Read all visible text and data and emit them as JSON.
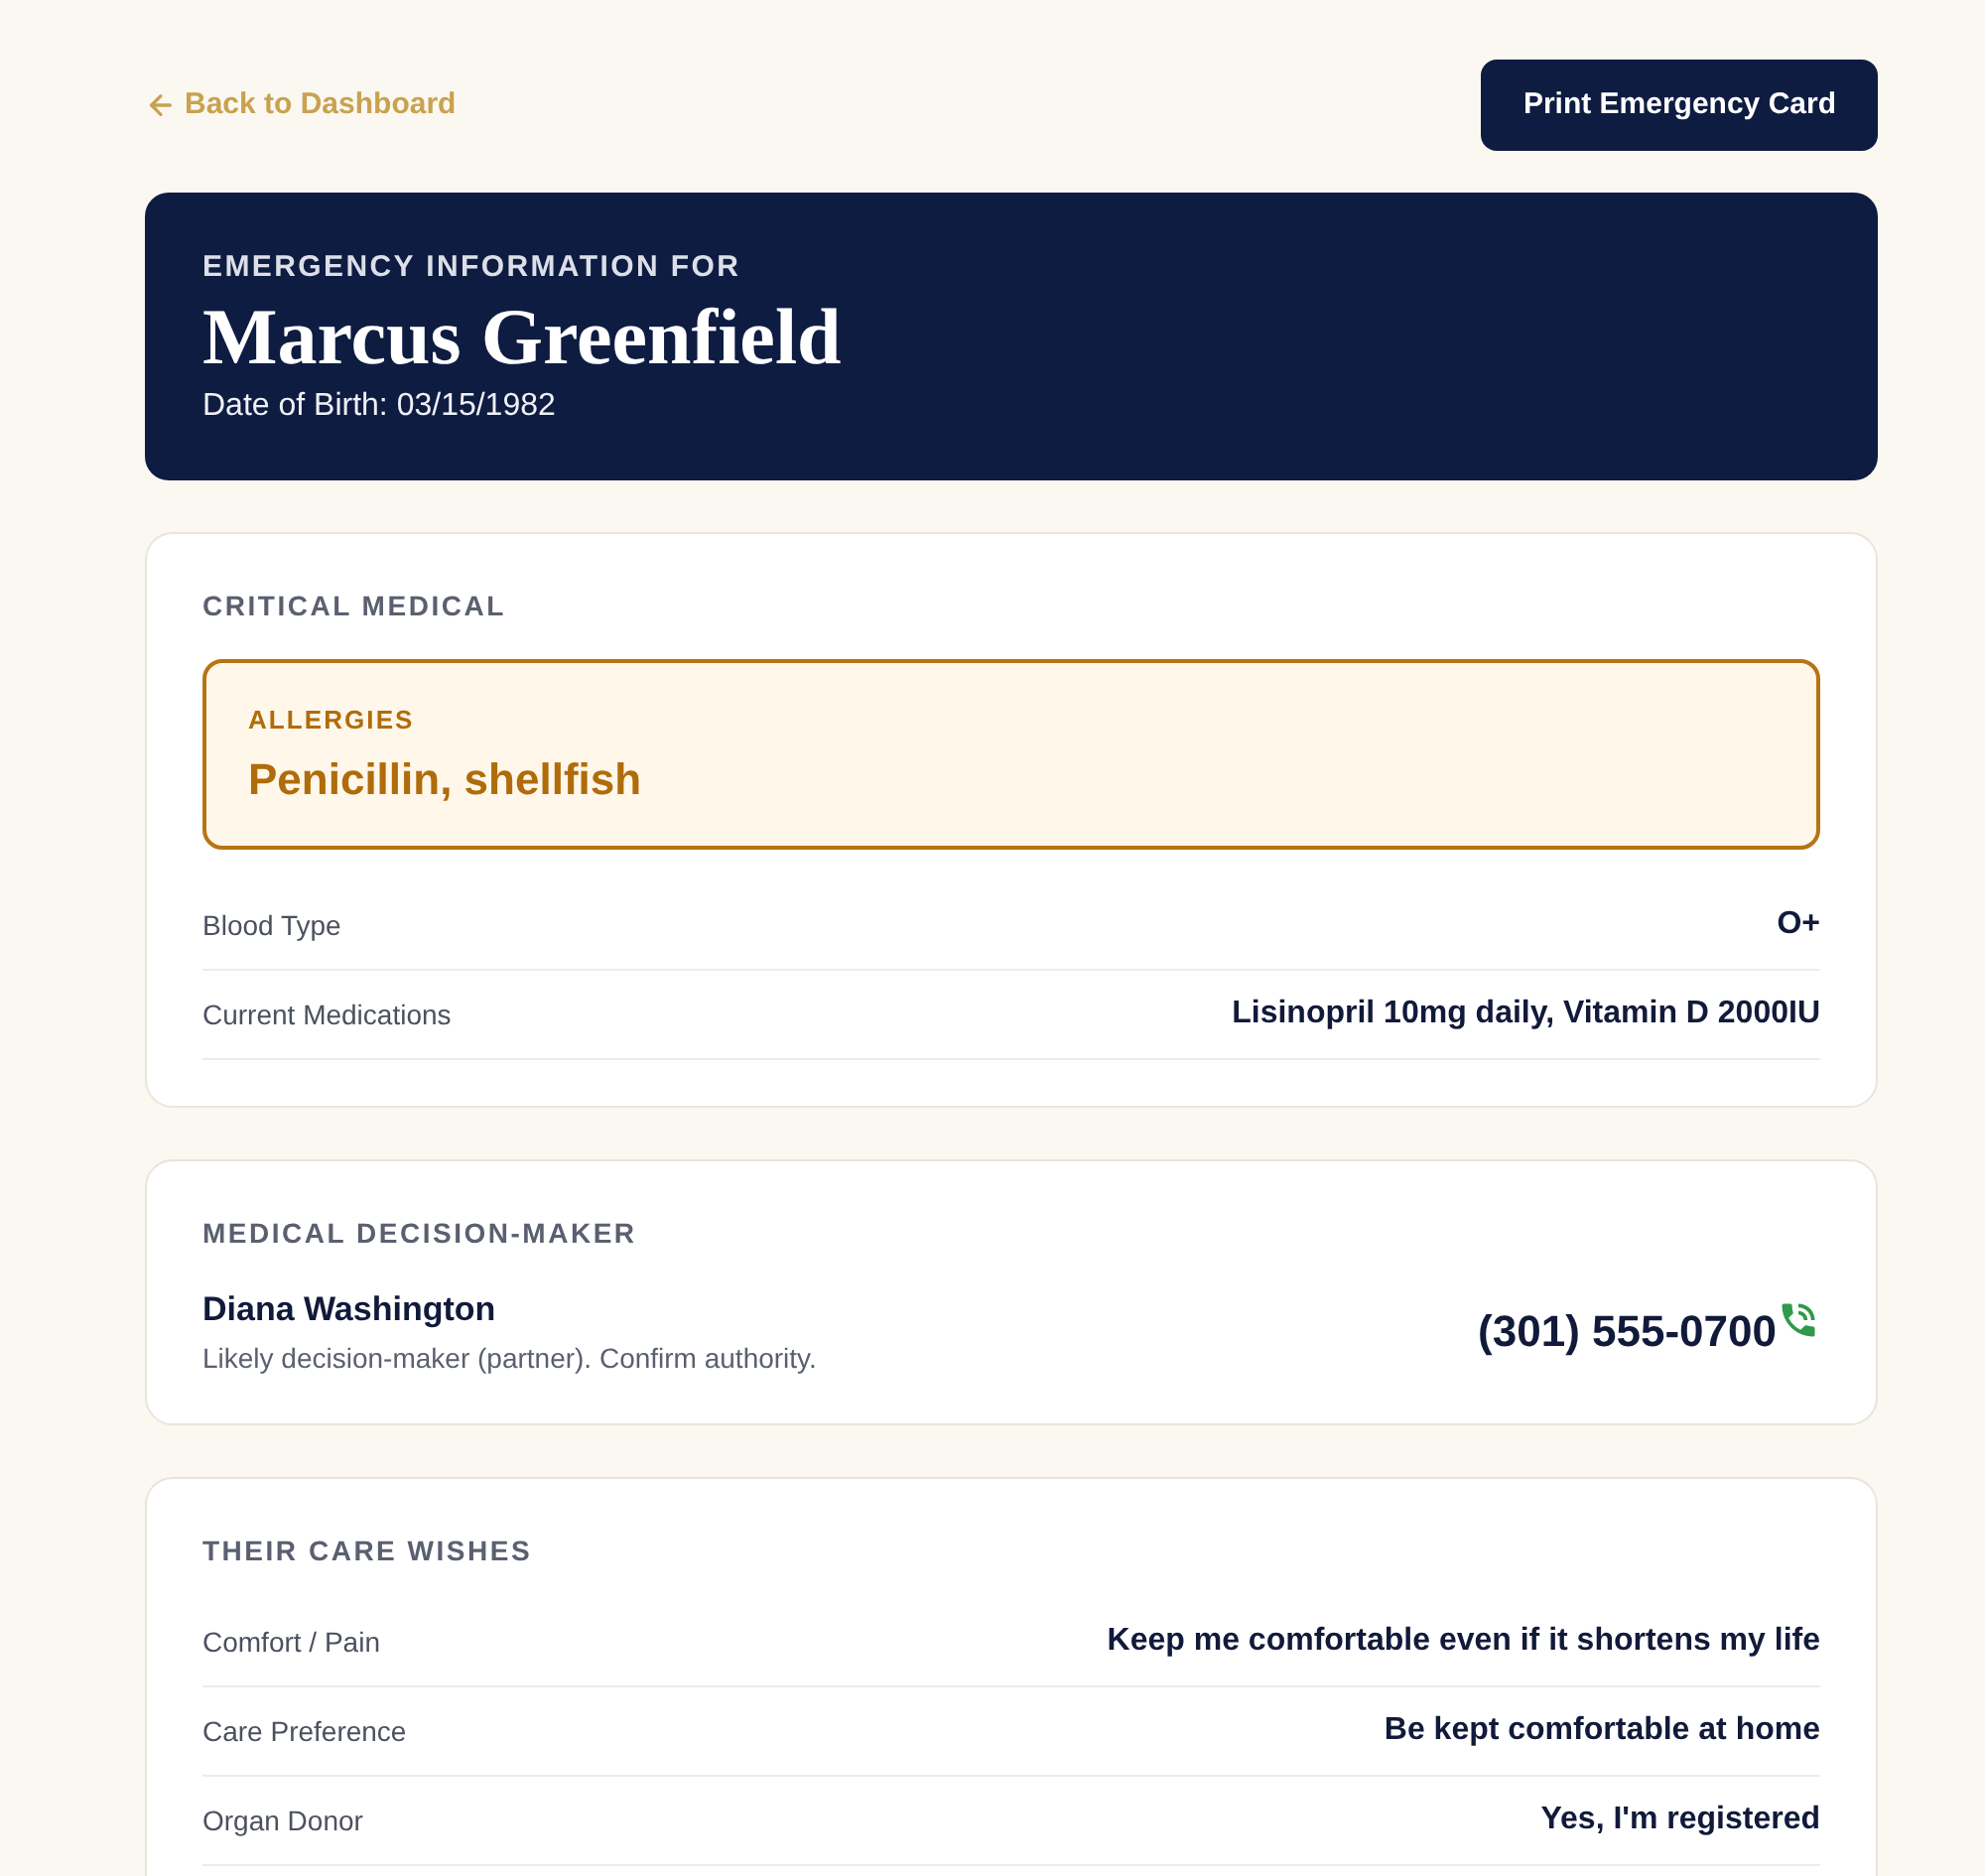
{
  "back_link": {
    "label": "Back to Dashboard"
  },
  "print_button": {
    "label": "Print Emergency Card"
  },
  "header": {
    "eyebrow": "EMERGENCY INFORMATION FOR",
    "name": "Marcus Greenfield",
    "dob": "Date of Birth: 03/15/1982"
  },
  "sections": [
    {
      "title": "CRITICAL MEDICAL",
      "alert": {
        "label": "ALLERGIES",
        "value": "Penicillin, shellfish"
      },
      "rows": [
        {
          "label": "Blood Type",
          "value": "O+"
        },
        {
          "label": "Current Medications",
          "value": "Lisinopril 10mg daily, Vitamin D 2000IU"
        }
      ]
    },
    {
      "title": "MEDICAL DECISION-MAKER",
      "contact": {
        "name": "Diana Washington",
        "note": "Likely decision-maker (partner). Confirm authority.",
        "phone": "(301) 555-0700"
      }
    },
    {
      "title": "THEIR CARE WISHES",
      "rows": [
        {
          "label": "Comfort / Pain",
          "value": "Keep me comfortable even if it shortens my life"
        },
        {
          "label": "Care Preference",
          "value": "Be kept comfortable at home"
        },
        {
          "label": "Organ Donor",
          "value": "Yes, I'm registered"
        }
      ]
    }
  ]
}
